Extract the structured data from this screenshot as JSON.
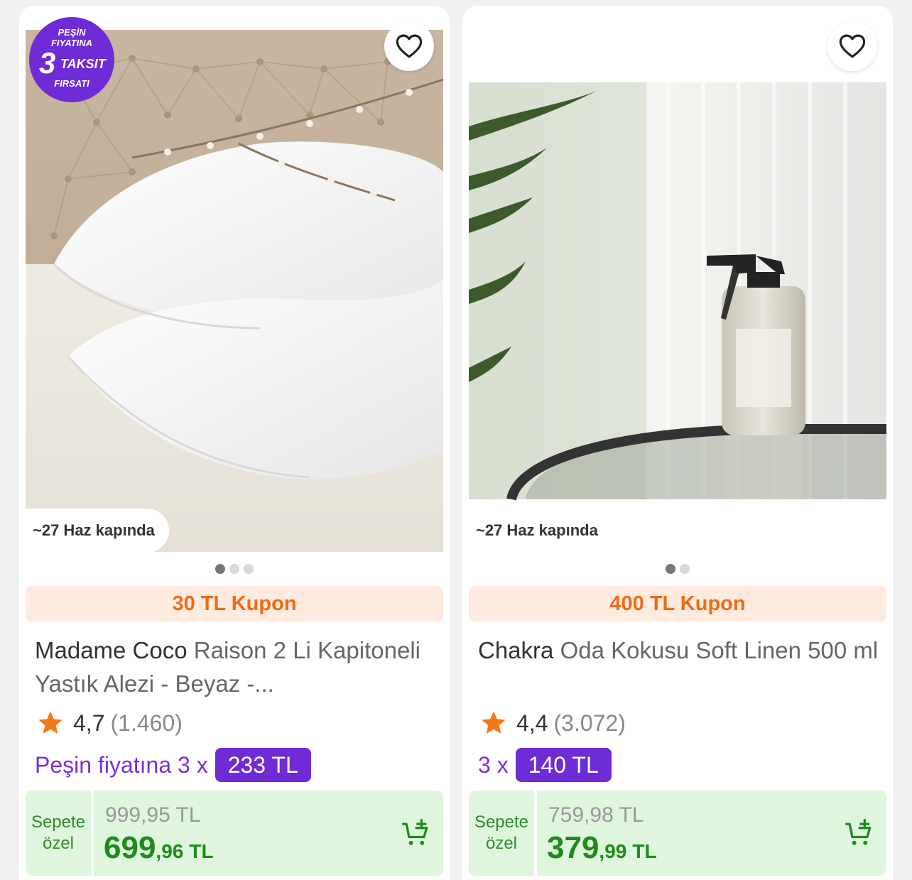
{
  "products": [
    {
      "promo_badge": {
        "line1": "PEŞİN",
        "line2": "FIYATINA",
        "number": "3",
        "word": "TAKSIT",
        "line4": "FIRSATI"
      },
      "delivery": "~27 Haz kapında",
      "dots": {
        "count": 3,
        "active": 0
      },
      "coupon": "30 TL Kupon",
      "brand": "Madame Coco",
      "name": "Raison 2 Li Kapitoneli Yastık Alezi - Beyaz -...",
      "rating": "4,7",
      "review_count": "(1.460)",
      "installment_text": "Peşin fiyatına 3 x",
      "installment_amount": "233 TL",
      "special_label_1": "Sepete",
      "special_label_2": "özel",
      "old_price": "999,95 TL",
      "price_int": "699",
      "price_dec": ",96",
      "price_currency": "TL"
    },
    {
      "delivery": "~27 Haz kapında",
      "dots": {
        "count": 2,
        "active": 0
      },
      "coupon": "400 TL Kupon",
      "brand": "Chakra",
      "name": "Oda Kokusu Soft Linen 500 ml",
      "rating": "4,4",
      "review_count": "(3.072)",
      "installment_text": "3 x",
      "installment_amount": "140 TL",
      "special_label_1": "Sepete",
      "special_label_2": "özel",
      "old_price": "759,98 TL",
      "price_int": "379",
      "price_dec": ",99",
      "price_currency": "TL"
    }
  ],
  "colors": {
    "coupon_text": "#f06b13",
    "coupon_bg": "#fdebe0",
    "installment_purple": "#6f2bd6",
    "price_green": "#1e8c1a",
    "price_box_bg": "#dff5de",
    "star_orange": "#f27a1a"
  },
  "icons": [
    "heart-outline-icon",
    "star-icon",
    "add-to-cart-icon"
  ]
}
